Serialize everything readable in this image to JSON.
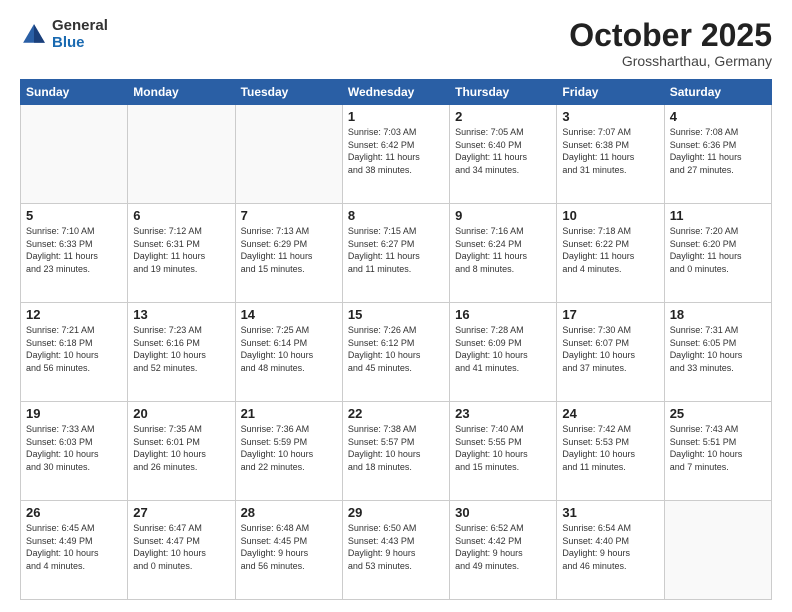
{
  "header": {
    "logo_general": "General",
    "logo_blue": "Blue",
    "month_title": "October 2025",
    "location": "Grossharthau, Germany"
  },
  "weekdays": [
    "Sunday",
    "Monday",
    "Tuesday",
    "Wednesday",
    "Thursday",
    "Friday",
    "Saturday"
  ],
  "weeks": [
    [
      {
        "day": "",
        "info": ""
      },
      {
        "day": "",
        "info": ""
      },
      {
        "day": "",
        "info": ""
      },
      {
        "day": "1",
        "info": "Sunrise: 7:03 AM\nSunset: 6:42 PM\nDaylight: 11 hours\nand 38 minutes."
      },
      {
        "day": "2",
        "info": "Sunrise: 7:05 AM\nSunset: 6:40 PM\nDaylight: 11 hours\nand 34 minutes."
      },
      {
        "day": "3",
        "info": "Sunrise: 7:07 AM\nSunset: 6:38 PM\nDaylight: 11 hours\nand 31 minutes."
      },
      {
        "day": "4",
        "info": "Sunrise: 7:08 AM\nSunset: 6:36 PM\nDaylight: 11 hours\nand 27 minutes."
      }
    ],
    [
      {
        "day": "5",
        "info": "Sunrise: 7:10 AM\nSunset: 6:33 PM\nDaylight: 11 hours\nand 23 minutes."
      },
      {
        "day": "6",
        "info": "Sunrise: 7:12 AM\nSunset: 6:31 PM\nDaylight: 11 hours\nand 19 minutes."
      },
      {
        "day": "7",
        "info": "Sunrise: 7:13 AM\nSunset: 6:29 PM\nDaylight: 11 hours\nand 15 minutes."
      },
      {
        "day": "8",
        "info": "Sunrise: 7:15 AM\nSunset: 6:27 PM\nDaylight: 11 hours\nand 11 minutes."
      },
      {
        "day": "9",
        "info": "Sunrise: 7:16 AM\nSunset: 6:24 PM\nDaylight: 11 hours\nand 8 minutes."
      },
      {
        "day": "10",
        "info": "Sunrise: 7:18 AM\nSunset: 6:22 PM\nDaylight: 11 hours\nand 4 minutes."
      },
      {
        "day": "11",
        "info": "Sunrise: 7:20 AM\nSunset: 6:20 PM\nDaylight: 11 hours\nand 0 minutes."
      }
    ],
    [
      {
        "day": "12",
        "info": "Sunrise: 7:21 AM\nSunset: 6:18 PM\nDaylight: 10 hours\nand 56 minutes."
      },
      {
        "day": "13",
        "info": "Sunrise: 7:23 AM\nSunset: 6:16 PM\nDaylight: 10 hours\nand 52 minutes."
      },
      {
        "day": "14",
        "info": "Sunrise: 7:25 AM\nSunset: 6:14 PM\nDaylight: 10 hours\nand 48 minutes."
      },
      {
        "day": "15",
        "info": "Sunrise: 7:26 AM\nSunset: 6:12 PM\nDaylight: 10 hours\nand 45 minutes."
      },
      {
        "day": "16",
        "info": "Sunrise: 7:28 AM\nSunset: 6:09 PM\nDaylight: 10 hours\nand 41 minutes."
      },
      {
        "day": "17",
        "info": "Sunrise: 7:30 AM\nSunset: 6:07 PM\nDaylight: 10 hours\nand 37 minutes."
      },
      {
        "day": "18",
        "info": "Sunrise: 7:31 AM\nSunset: 6:05 PM\nDaylight: 10 hours\nand 33 minutes."
      }
    ],
    [
      {
        "day": "19",
        "info": "Sunrise: 7:33 AM\nSunset: 6:03 PM\nDaylight: 10 hours\nand 30 minutes."
      },
      {
        "day": "20",
        "info": "Sunrise: 7:35 AM\nSunset: 6:01 PM\nDaylight: 10 hours\nand 26 minutes."
      },
      {
        "day": "21",
        "info": "Sunrise: 7:36 AM\nSunset: 5:59 PM\nDaylight: 10 hours\nand 22 minutes."
      },
      {
        "day": "22",
        "info": "Sunrise: 7:38 AM\nSunset: 5:57 PM\nDaylight: 10 hours\nand 18 minutes."
      },
      {
        "day": "23",
        "info": "Sunrise: 7:40 AM\nSunset: 5:55 PM\nDaylight: 10 hours\nand 15 minutes."
      },
      {
        "day": "24",
        "info": "Sunrise: 7:42 AM\nSunset: 5:53 PM\nDaylight: 10 hours\nand 11 minutes."
      },
      {
        "day": "25",
        "info": "Sunrise: 7:43 AM\nSunset: 5:51 PM\nDaylight: 10 hours\nand 7 minutes."
      }
    ],
    [
      {
        "day": "26",
        "info": "Sunrise: 6:45 AM\nSunset: 4:49 PM\nDaylight: 10 hours\nand 4 minutes."
      },
      {
        "day": "27",
        "info": "Sunrise: 6:47 AM\nSunset: 4:47 PM\nDaylight: 10 hours\nand 0 minutes."
      },
      {
        "day": "28",
        "info": "Sunrise: 6:48 AM\nSunset: 4:45 PM\nDaylight: 9 hours\nand 56 minutes."
      },
      {
        "day": "29",
        "info": "Sunrise: 6:50 AM\nSunset: 4:43 PM\nDaylight: 9 hours\nand 53 minutes."
      },
      {
        "day": "30",
        "info": "Sunrise: 6:52 AM\nSunset: 4:42 PM\nDaylight: 9 hours\nand 49 minutes."
      },
      {
        "day": "31",
        "info": "Sunrise: 6:54 AM\nSunset: 4:40 PM\nDaylight: 9 hours\nand 46 minutes."
      },
      {
        "day": "",
        "info": ""
      }
    ]
  ]
}
